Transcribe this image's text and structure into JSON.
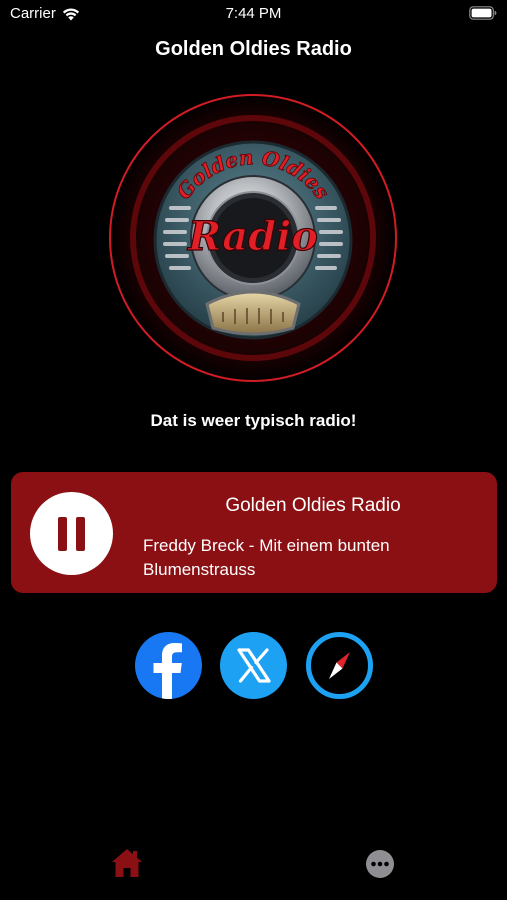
{
  "status_bar": {
    "carrier": "Carrier",
    "time": "7:44 PM"
  },
  "header": {
    "title": "Golden Oldies Radio"
  },
  "logo": {
    "top_text": "Golden Oldies",
    "main_text": "Radio"
  },
  "tagline": "Dat is weer typisch radio!",
  "player": {
    "station": "Golden Oldies Radio",
    "track": "Freddy Breck - Mit einem bunten Blumenstrauss",
    "state": "playing"
  },
  "social": [
    {
      "name": "facebook-icon"
    },
    {
      "name": "x-icon"
    },
    {
      "name": "compass-icon"
    }
  ],
  "tabs": [
    {
      "name": "home-icon",
      "active": true
    },
    {
      "name": "more-icon",
      "active": false
    }
  ],
  "colors": {
    "background": "#000000",
    "accent": "#8b1014",
    "facebook": "#1877f2",
    "twitter": "#1da1f2",
    "tab_active": "#8b1014",
    "tab_inactive": "#8e8e93"
  }
}
